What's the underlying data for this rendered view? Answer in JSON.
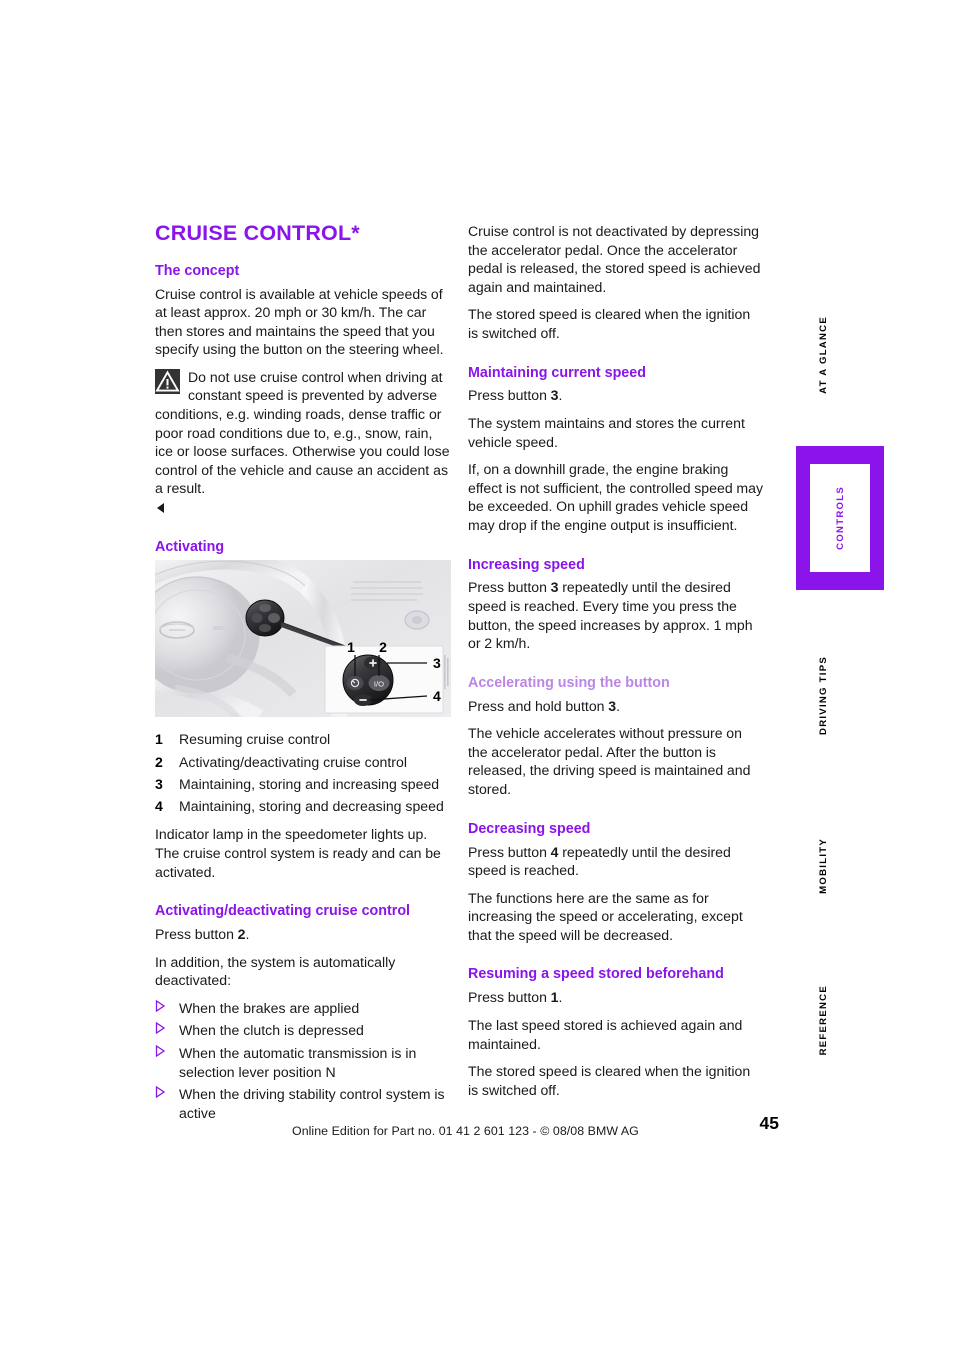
{
  "document": {
    "title": "CRUISE CONTROL*",
    "page_number": "45",
    "footer": "Online Edition for Part no. 01 41 2 601 123  - © 08/08 BMW AG"
  },
  "left_column": {
    "concept": {
      "heading": "The concept",
      "paragraph": "Cruise control is available at vehicle speeds of at least approx. 20 mph or 30 km/h. The car then stores and maintains the speed that you specify using the button on the steering wheel.",
      "warning": "Do not use cruise control when driving at constant speed is prevented by adverse conditions, e.g. winding roads, dense traffic or poor road conditions due to, e.g., snow, rain, ice or loose surfaces. Otherwise you could lose control of the vehicle and cause an accident as a result."
    },
    "activating": {
      "heading": "Activating",
      "figure_caption_items": [
        {
          "num": "1",
          "text": "Resuming cruise control"
        },
        {
          "num": "2",
          "text": "Activating/deactivating cruise control"
        },
        {
          "num": "3",
          "text": "Maintaining, storing and increasing speed"
        },
        {
          "num": "4",
          "text": "Maintaining, storing and decreasing speed"
        }
      ],
      "figure_labels": {
        "callout_1": "1",
        "callout_2": "2",
        "callout_3": "3",
        "callout_4": "4",
        "button_io": "I/O",
        "button_plus": "+",
        "button_minus": "−"
      },
      "paragraph": "Indicator lamp in the speedometer lights up. The cruise control system is ready and can be activated."
    },
    "activating_deactivating": {
      "heading": "Activating/deactivating cruise control",
      "press_button": "Press button ",
      "press_button_num": "2",
      "press_button_end": ".",
      "intro": "In addition, the system is automatically deactivated:",
      "items": [
        "When the brakes are applied",
        "When the clutch is depressed",
        "When the automatic transmission is in selection lever position N",
        "When the driving stability control system is active"
      ]
    }
  },
  "right_column": {
    "continued": {
      "paragraph1": "Cruise control is not deactivated by depressing the accelerator pedal. Once the accelerator pedal is released, the stored speed is achieved again and maintained.",
      "paragraph2": "The stored speed is cleared when the ignition is switched off."
    },
    "maintaining": {
      "heading": "Maintaining current speed",
      "press_button": "Press button ",
      "press_button_num": "3",
      "press_button_end": ".",
      "paragraph1": "The system maintains and stores the current vehicle speed.",
      "paragraph2": "If, on a downhill grade, the engine braking effect is not sufficient, the controlled speed may be exceeded. On uphill grades vehicle speed may drop if the engine output is insufficient."
    },
    "increasing": {
      "heading": "Increasing speed",
      "press_button": "Press button ",
      "press_button_num": "3",
      "press_button_end": " repeatedly until the desired speed is reached. Every time you press the button, the speed increases by approx. 1 mph or 2 km/h."
    },
    "accelerating": {
      "heading": "Accelerating using the button",
      "press_button": "Press and hold button ",
      "press_button_num": "3",
      "press_button_end": ".",
      "paragraph": "The vehicle accelerates without pressure on the accelerator pedal. After the button is released, the driving speed is maintained and stored."
    },
    "decreasing": {
      "heading": "Decreasing speed",
      "press_button": "Press button ",
      "press_button_num": "4",
      "press_button_end": " repeatedly until the desired speed is reached.",
      "paragraph": "The functions here are the same as for increasing the speed or accelerating, except that the speed will be decreased."
    },
    "resuming": {
      "heading": "Resuming a speed stored beforehand",
      "press_button": "Press button ",
      "press_button_num": "1",
      "press_button_end": ".",
      "paragraph1": "The last speed stored is achieved again and maintained.",
      "paragraph2": "The stored speed is cleared when the ignition is switched off."
    }
  },
  "side_tabs": [
    {
      "label": "AT A GLANCE",
      "active": false
    },
    {
      "label": "CONTROLS",
      "active": true
    },
    {
      "label": "DRIVING TIPS",
      "active": false
    },
    {
      "label": "MOBILITY",
      "active": false
    },
    {
      "label": "REFERENCE",
      "active": false
    }
  ],
  "colors": {
    "accent_purple": "#8A14EA",
    "light_purple": "#BB86E6",
    "text": "#1a1a1a"
  }
}
